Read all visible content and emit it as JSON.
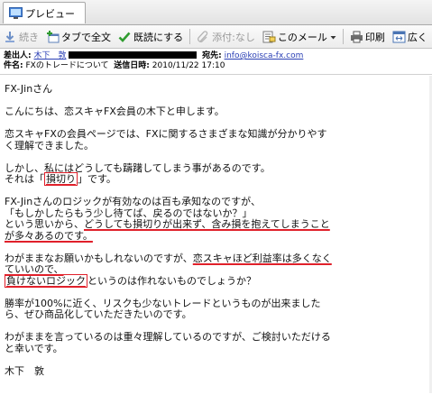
{
  "tab": {
    "title": "プレビュー"
  },
  "toolbar": {
    "continue": "続き",
    "forward_tab": "タブで全文",
    "mark_read": "既読にする",
    "attach": "添付:なし",
    "this_mail": "このメール",
    "print": "印刷",
    "wide": "広く"
  },
  "header": {
    "from_label": "差出人:",
    "from_name": "木下　敦",
    "to_label": "宛先:",
    "to_addr": "info@koisca-fx.com",
    "subject_label": "件名:",
    "subject": "FXのトレードについて",
    "sent_label": "送信日時:",
    "sent": "2010/11/22 17:10"
  },
  "body": {
    "greeting": "FX-Jinさん",
    "p1": "こんにちは、恋スキャFX会員の木下と申します。",
    "p2": "恋スキャFXの会員ページでは、FXに関するさまざまな知識が分かりやすく理解できました。",
    "p3_a": "しかし、私にはどうしても躊躇してしまう事があるのです。",
    "p3_b1": "それは「",
    "p3_b2": "損切り",
    "p3_b3": "」です。",
    "p4_a": "FX-Jinさんのロジックが有効なのは百も承知なのですが、",
    "p4_b": "「もしかしたらもう少し待てば、戻るのではないか？」",
    "p4_c1": "という思いから、",
    "p4_c2": "どうしても損切りが出来ず、含み損を抱えてしまうことが多々あるのです。",
    "p5_a1": "わがままなお願いかもしれないのですが、",
    "p5_a2": "恋スキャほど利益率は多くなくていいので、",
    "p5_b1": "負けないロジック",
    "p5_b2": "というのは作れないものでしょうか？",
    "p6": "勝率が100%に近く、リスクも少ないトレードというものが出来ましたら、ぜひ商品化していただきたいのです。",
    "p7": "わがままを言っているのは重々理解しているのですが、ご検討いただけると幸いです。",
    "signature": "木下　敦"
  }
}
